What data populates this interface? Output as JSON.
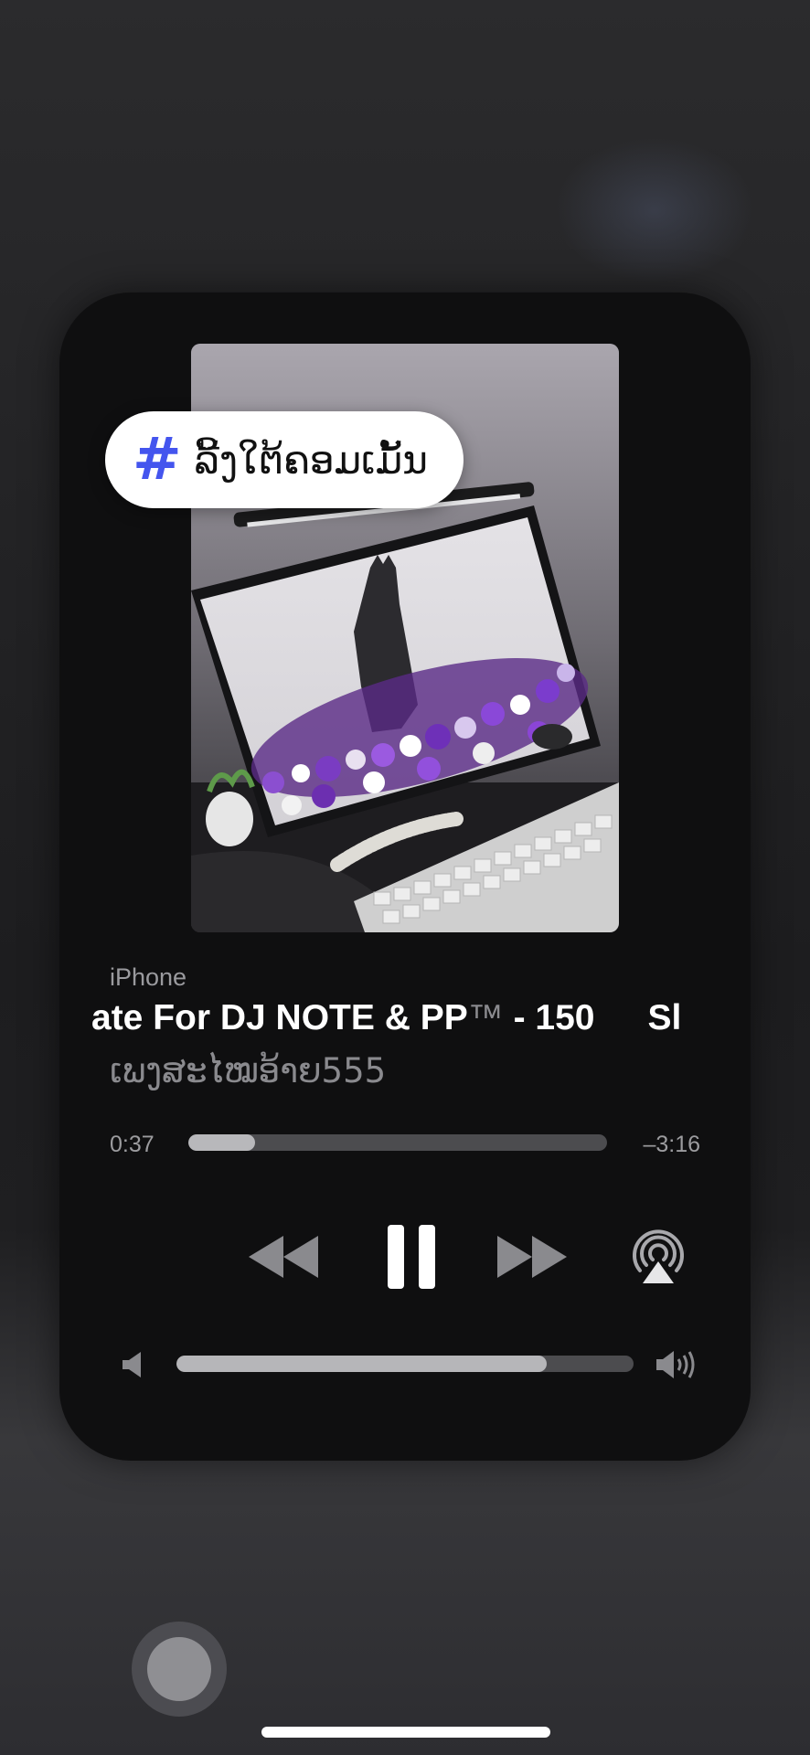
{
  "hashtag": {
    "icon": "hashtag-icon",
    "text": "ລີ້ງໃຕ້ຄອມເມັ້ນ",
    "icon_color": "#4455ee"
  },
  "now_playing": {
    "source": "iPhone",
    "title_main": "ate For DJ NOTE & PP",
    "title_tm": "™",
    "title_tail": " - 150",
    "title_next": "Sl",
    "artist": "ເພງສະໄໝອ້າຍ555",
    "elapsed": "0:37",
    "remaining": "–3:16",
    "progress_fraction": 0.16
  },
  "controls": {
    "rewind": "rewind-icon",
    "pause": "pause-icon",
    "forward": "fast-forward-icon",
    "airplay": "airplay-icon"
  },
  "volume": {
    "fraction": 0.81,
    "low_icon": "volume-low-icon",
    "high_icon": "volume-high-icon"
  }
}
